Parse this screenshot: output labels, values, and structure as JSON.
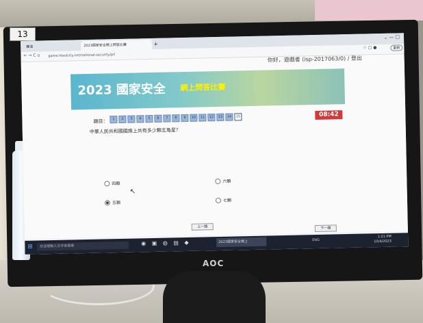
{
  "monitor": {
    "label": "13",
    "brand": "AOC"
  },
  "browser": {
    "tabs": [
      {
        "label": "賽道"
      },
      {
        "label": "2023國家安全網上問答比賽"
      }
    ],
    "new_tab": "+",
    "window_controls": "⌄  —  ☐",
    "url": "game.hkedcity.net/national-security/pri",
    "update_button": "更新",
    "nav_icons": "← → C ⌂",
    "toolbar_icons": "☆ ▢ ●"
  },
  "page": {
    "user_info": "你好，遊戲者 (isp-2017063/0) / 登出",
    "banner": {
      "title": "2023 國家安全",
      "subtitle": "網上問答比賽"
    },
    "question_label": "題目：",
    "question_numbers": [
      "1",
      "2",
      "3",
      "4",
      "5",
      "6",
      "7",
      "8",
      "9",
      "10",
      "11",
      "12",
      "13",
      "14",
      "15"
    ],
    "current_question": "15",
    "timer": "08:42",
    "question": "中華人民共和國國旗上共有多少顆五角星？",
    "options": [
      {
        "label": "四顆",
        "selected": false
      },
      {
        "label": "六顆",
        "selected": false
      },
      {
        "label": "五顆",
        "selected": true
      },
      {
        "label": "七顆",
        "selected": false
      }
    ],
    "prev_button": "上一題",
    "next_button": "下一題"
  },
  "taskbar": {
    "search_placeholder": "在這裡輸入文字來搜尋",
    "active_window": "2023國家安全網上",
    "clock_time": "1:21 PM",
    "clock_date": "10/4/2023",
    "tray": "ENG"
  }
}
